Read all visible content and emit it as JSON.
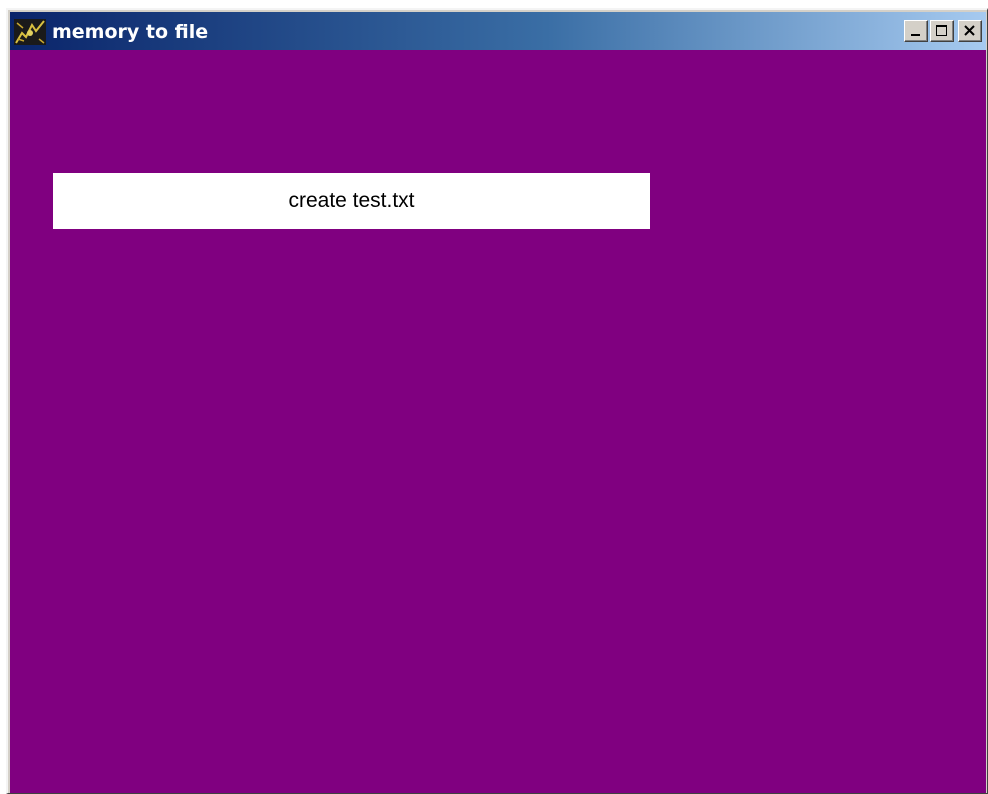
{
  "window": {
    "title": "memory to file",
    "icon": "app-icon",
    "controls": {
      "minimize_icon": "minimize-icon",
      "maximize_icon": "maximize-icon",
      "close_icon": "close-icon"
    }
  },
  "main": {
    "background_color": "#800080",
    "create_button_label": "create test.txt"
  }
}
